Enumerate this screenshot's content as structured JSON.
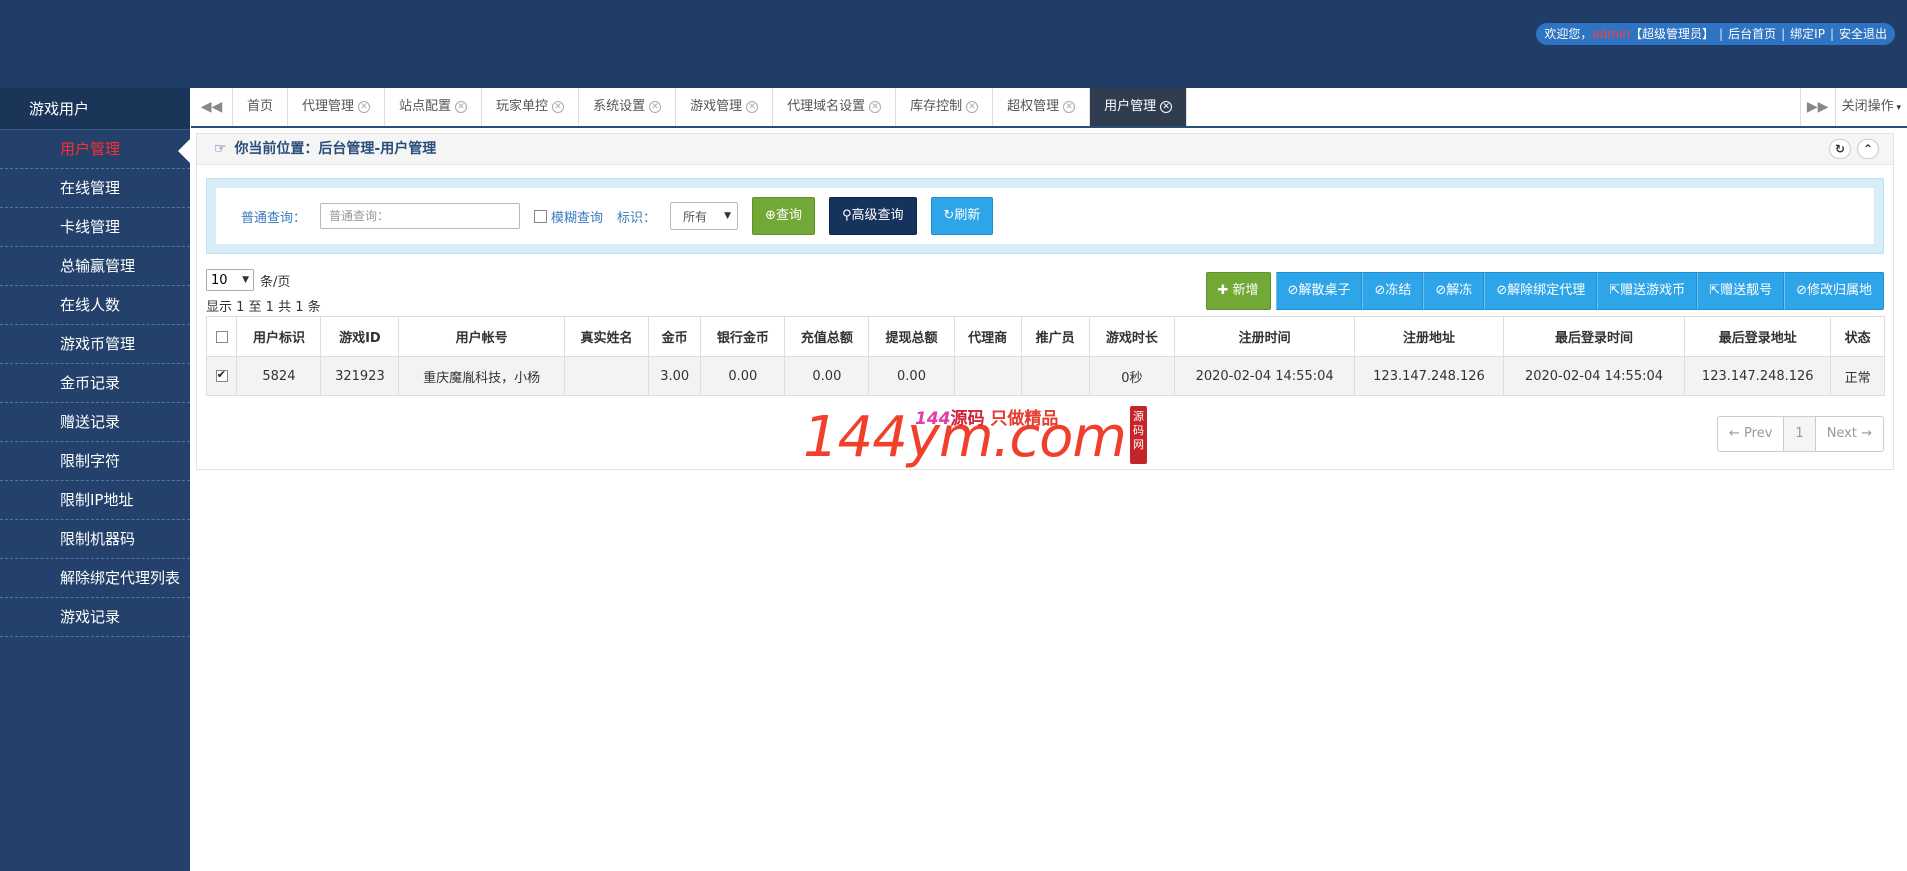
{
  "header": {
    "welcome_prefix": "欢迎您，",
    "user": "admin",
    "role": "【超级管理员】",
    "links": [
      "后台首页",
      "绑定IP",
      "安全退出"
    ]
  },
  "sidebar": {
    "title": "游戏用户",
    "items": [
      {
        "label": "用户管理",
        "active": true
      },
      {
        "label": "在线管理"
      },
      {
        "label": "卡线管理"
      },
      {
        "label": "总输赢管理"
      },
      {
        "label": "在线人数"
      },
      {
        "label": "游戏币管理"
      },
      {
        "label": "金币记录"
      },
      {
        "label": "赠送记录"
      },
      {
        "label": "限制字符"
      },
      {
        "label": "限制IP地址"
      },
      {
        "label": "限制机器码"
      },
      {
        "label": "解除绑定代理列表"
      },
      {
        "label": "游戏记录"
      }
    ]
  },
  "tabs": {
    "items": [
      "首页",
      "代理管理",
      "站点配置",
      "玩家单控",
      "系统设置",
      "游戏管理",
      "代理域名设置",
      "库存控制",
      "超权管理",
      "用户管理"
    ],
    "active": "用户管理",
    "close_ops": "关闭操作"
  },
  "location": {
    "text": "你当前位置：后台管理-用户管理"
  },
  "search": {
    "label": "普通查询：",
    "placeholder": "普通查询：",
    "fuzzy_label": "模糊查询",
    "flag_label": "标识：",
    "flag_value": "所有",
    "query_btn": "查询",
    "advanced_btn": "高级查询",
    "refresh_btn": "刷新"
  },
  "paging": {
    "per_page": "10",
    "per_page_unit": "条/页",
    "summary": "显示 1 至 1 共 1 条",
    "prev": "← Prev",
    "current": "1",
    "next": "Next →"
  },
  "actions": [
    "新增",
    "解散桌子",
    "冻结",
    "解冻",
    "解除绑定代理",
    "赠送游戏币",
    "赠送靓号",
    "修改归属地"
  ],
  "table": {
    "columns": [
      "用户标识",
      "游戏ID",
      "用户帐号",
      "真实姓名",
      "金币",
      "银行金币",
      "充值总额",
      "提现总额",
      "代理商",
      "推广员",
      "游戏时长",
      "注册时间",
      "注册地址",
      "最后登录时间",
      "最后登录地址",
      "状态"
    ],
    "rows": [
      [
        "5824",
        "321923",
        "重庆魔胤科技，小杨",
        "",
        "3.00",
        "0.00",
        "0.00",
        "0.00",
        "",
        "",
        "0秒",
        "2020-02-04 14:55:04",
        "123.147.248.126",
        "2020-02-04 14:55:04",
        "123.147.248.126",
        "正常"
      ]
    ]
  },
  "watermark": {
    "big": "144ym.com",
    "small_num": "144",
    "small_txt1": "源码",
    "small_txt2": "只做精品",
    "seal": "源码网"
  },
  "colors": {
    "header_bg": "#1f3d66",
    "sidebar_bg": "#23416b",
    "active_red": "#ff2e2e",
    "btn_blue": "#2ea5e8",
    "btn_green": "#71a836",
    "btn_navy": "#16335d",
    "status_green": "#4a9e2c"
  }
}
